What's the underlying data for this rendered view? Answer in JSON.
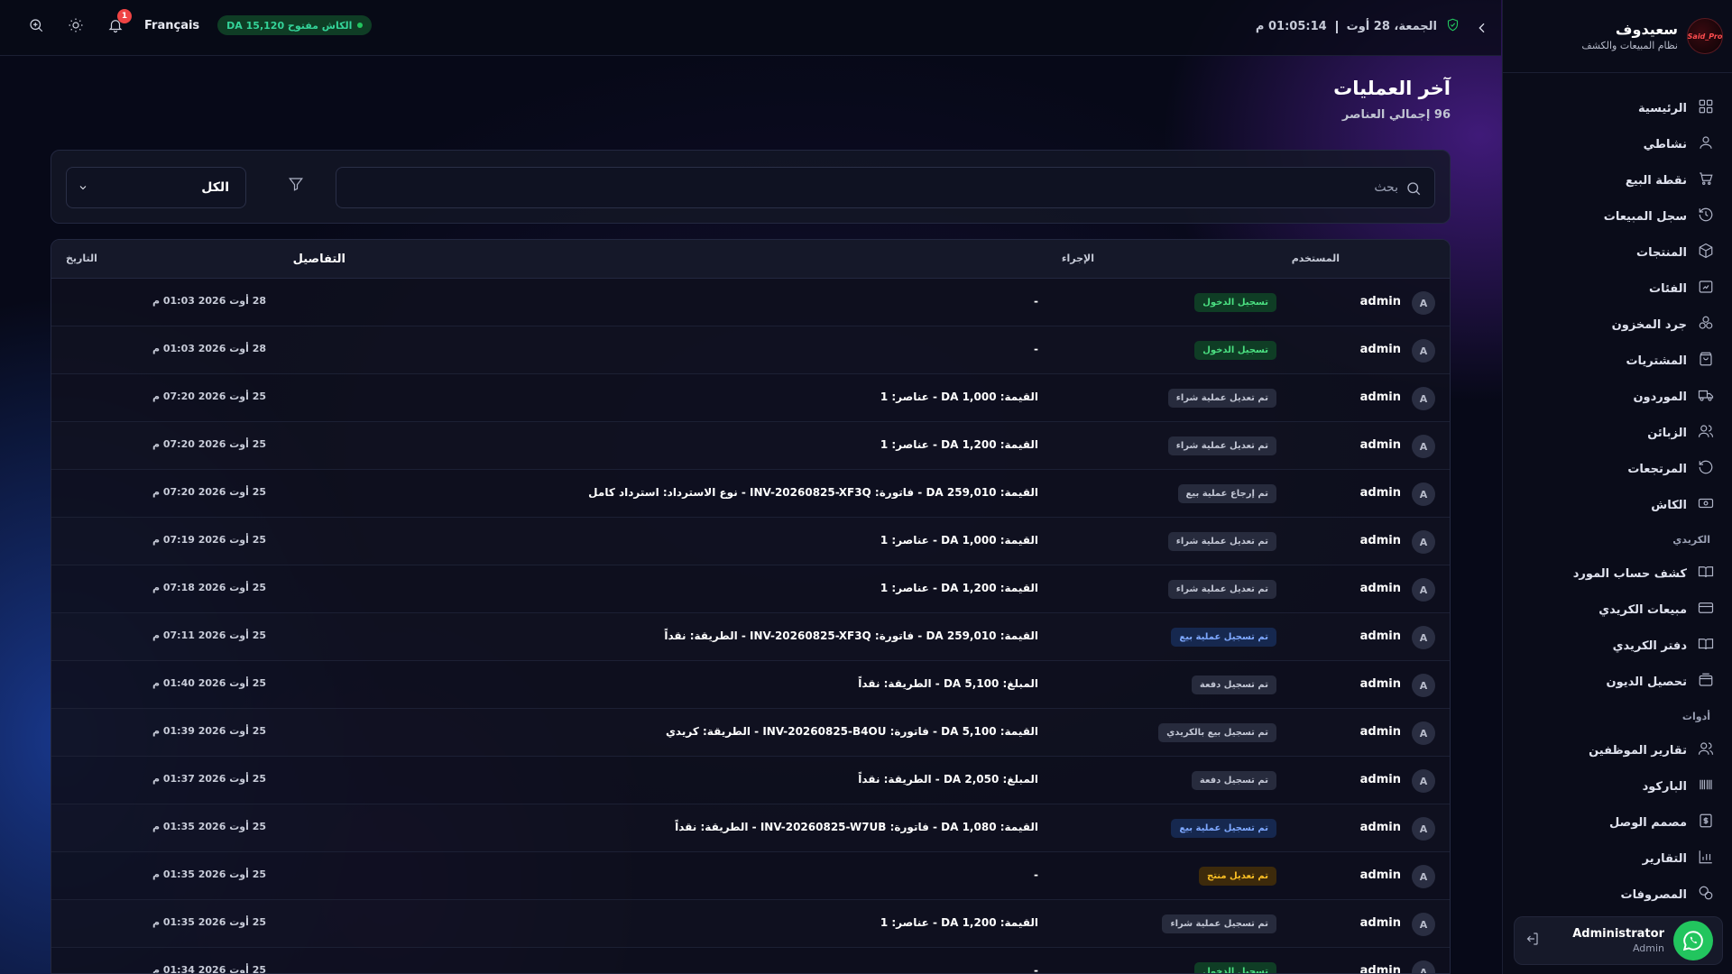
{
  "brand": {
    "name": "سعيدوف",
    "subtitle": "نظام المبيعات والكشف",
    "logo_text": "Said_Pro"
  },
  "topbar": {
    "date": "الجمعة، 28 أوت",
    "time": "01:05:14 م",
    "language": "Français",
    "cashier_status": "الكاش مفتوح DA 15,120",
    "notification_count": "1"
  },
  "nav": {
    "items": [
      {
        "label": "الرئيسية",
        "icon": "dashboard-icon"
      },
      {
        "label": "نشاطي",
        "icon": "user-icon"
      },
      {
        "label": "نقطة البيع",
        "icon": "cart-icon"
      },
      {
        "label": "سجل المبيعات",
        "icon": "history-icon"
      },
      {
        "label": "المنتجات",
        "icon": "box-icon"
      },
      {
        "label": "الفئات",
        "icon": "folder-icon"
      },
      {
        "label": "جرد المخزون",
        "icon": "boxes-icon"
      },
      {
        "label": "المشتريات",
        "icon": "bag-icon"
      },
      {
        "label": "الموردون",
        "icon": "truck-icon"
      },
      {
        "label": "الزبائن",
        "icon": "users-icon"
      },
      {
        "label": "المرتجعات",
        "icon": "return-icon"
      },
      {
        "label": "الكاش",
        "icon": "cash-icon"
      }
    ],
    "section_credit": "الكريدي",
    "credit_items": [
      {
        "label": "كشف حساب المورد",
        "icon": "book-icon"
      },
      {
        "label": "مبيعات الكريدي",
        "icon": "card-icon"
      },
      {
        "label": "دفتر الكريدي",
        "icon": "book-icon"
      },
      {
        "label": "تحصيل الديون",
        "icon": "wallet-icon"
      }
    ],
    "section_tools": "أدوات",
    "tool_items": [
      {
        "label": "تقارير الموظفين",
        "icon": "users-icon"
      },
      {
        "label": "الباركود",
        "icon": "barcode-icon"
      },
      {
        "label": "مصمم الوصل",
        "icon": "receipt-icon"
      },
      {
        "label": "التقارير",
        "icon": "chart-icon"
      },
      {
        "label": "المصروفات",
        "icon": "coins-icon"
      }
    ]
  },
  "profile": {
    "name": "Administrator",
    "role": "Admin"
  },
  "page": {
    "title": "آخر العمليات",
    "subtitle": "96 إجمالي العناصر"
  },
  "filters": {
    "search_placeholder": "بحث",
    "select_value": "الكل"
  },
  "table": {
    "headers": {
      "user": "المستخدم",
      "action": "الإجراء",
      "details": "التفاصيل",
      "date": "التاريخ"
    },
    "rows": [
      {
        "avatar": "A",
        "user": "admin",
        "action": "تسجيل الدخول",
        "tone": "green",
        "details": "-",
        "date": "28 أوت 2026 01:03 م"
      },
      {
        "avatar": "A",
        "user": "admin",
        "action": "تسجيل الدخول",
        "tone": "green",
        "details": "-",
        "date": "28 أوت 2026 01:03 م"
      },
      {
        "avatar": "A",
        "user": "admin",
        "action": "تم تعديل عملية شراء",
        "tone": "gray",
        "details": "القيمة: DA 1,000 - عناصر: 1",
        "date": "25 أوت 2026 07:20 م"
      },
      {
        "avatar": "A",
        "user": "admin",
        "action": "تم تعديل عملية شراء",
        "tone": "gray",
        "details": "القيمة: DA 1,200 - عناصر: 1",
        "date": "25 أوت 2026 07:20 م"
      },
      {
        "avatar": "A",
        "user": "admin",
        "action": "تم إرجاع عملية بيع",
        "tone": "gray",
        "details": "القيمة: DA 259,010 - فاتورة: INV-20260825-XF3Q - نوع الاسترداد: استرداد كامل",
        "date": "25 أوت 2026 07:20 م"
      },
      {
        "avatar": "A",
        "user": "admin",
        "action": "تم تعديل عملية شراء",
        "tone": "gray",
        "details": "القيمة: DA 1,000 - عناصر: 1",
        "date": "25 أوت 2026 07:19 م"
      },
      {
        "avatar": "A",
        "user": "admin",
        "action": "تم تعديل عملية شراء",
        "tone": "gray",
        "details": "القيمة: DA 1,200 - عناصر: 1",
        "date": "25 أوت 2026 07:18 م"
      },
      {
        "avatar": "A",
        "user": "admin",
        "action": "تم تسجيل عملية بيع",
        "tone": "blue",
        "details": "القيمة: DA 259,010 - فاتورة: INV-20260825-XF3Q - الطريقة: نقداً",
        "date": "25 أوت 2026 07:11 م"
      },
      {
        "avatar": "A",
        "user": "admin",
        "action": "تم تسجيل دفعة",
        "tone": "gray",
        "details": "المبلغ: DA 5,100 - الطريقة: نقداً",
        "date": "25 أوت 2026 01:40 م"
      },
      {
        "avatar": "A",
        "user": "admin",
        "action": "تم تسجيل بيع بالكريدي",
        "tone": "gray",
        "details": "القيمة: DA 5,100 - فاتورة: INV-20260825-B4OU - الطريقة: كريدي",
        "date": "25 أوت 2026 01:39 م"
      },
      {
        "avatar": "A",
        "user": "admin",
        "action": "تم تسجيل دفعة",
        "tone": "gray",
        "details": "المبلغ: DA 2,050 - الطريقة: نقداً",
        "date": "25 أوت 2026 01:37 م"
      },
      {
        "avatar": "A",
        "user": "admin",
        "action": "تم تسجيل عملية بيع",
        "tone": "blue",
        "details": "القيمة: DA 1,080 - فاتورة: INV-20260825-W7UB - الطريقة: نقداً",
        "date": "25 أوت 2026 01:35 م"
      },
      {
        "avatar": "A",
        "user": "admin",
        "action": "تم تعديل منتج",
        "tone": "amber",
        "details": "-",
        "date": "25 أوت 2026 01:35 م"
      },
      {
        "avatar": "A",
        "user": "admin",
        "action": "تم تسجيل عملية شراء",
        "tone": "gray",
        "details": "القيمة: DA 1,200 - عناصر: 1",
        "date": "25 أوت 2026 01:35 م"
      },
      {
        "avatar": "A",
        "user": "admin",
        "action": "تسجيل الدخول",
        "tone": "green",
        "details": "-",
        "date": "25 أوت 2026 01:34 م"
      }
    ]
  },
  "colors": {
    "accent_green": "#22c55e",
    "badge_red": "#ef4444",
    "bg": "#070918"
  }
}
